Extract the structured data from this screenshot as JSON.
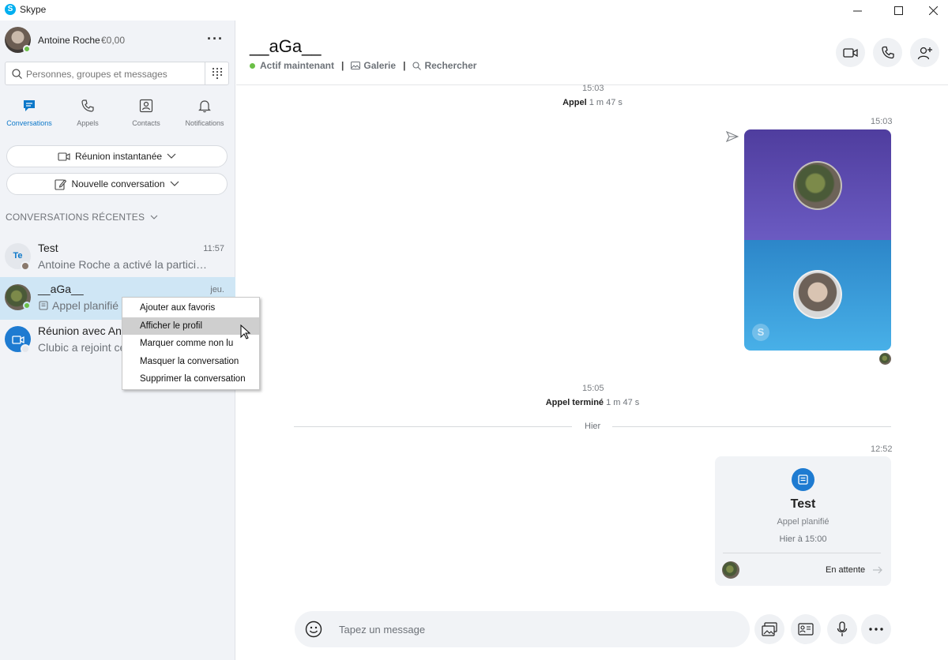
{
  "window": {
    "app_name": "Skype",
    "minimize_icon": "minimize-icon",
    "maximize_icon": "maximize-icon",
    "close_icon": "close-icon"
  },
  "profile": {
    "name": "Antoine Roche",
    "credit": "€0,00",
    "status": "online"
  },
  "search": {
    "placeholder": "Personnes, groupes et messages"
  },
  "nav": {
    "tabs": [
      {
        "label": "Conversations",
        "icon": "chat-icon",
        "active": true
      },
      {
        "label": "Appels",
        "icon": "phone-icon",
        "active": false
      },
      {
        "label": "Contacts",
        "icon": "contacts-icon",
        "active": false
      },
      {
        "label": "Notifications",
        "icon": "bell-icon",
        "active": false
      }
    ]
  },
  "actions": {
    "meet_now": "Réunion instantanée",
    "new_chat": "Nouvelle conversation"
  },
  "recent": {
    "title": "CONVERSATIONS RÉCENTES",
    "items": [
      {
        "name": "Test",
        "initials": "Te",
        "preview": "Antoine Roche a activé la partici…",
        "time": "11:57"
      },
      {
        "name": "__aGa__",
        "preview": "Appel planifié",
        "time": "jeu."
      },
      {
        "name": "Réunion avec Antoine Roche",
        "preview": "Clubic a rejoint cette conversation",
        "time": ""
      }
    ]
  },
  "context_menu": {
    "items": [
      "Ajouter aux favoris",
      "Afficher le profil",
      "Marquer comme non lu",
      "Masquer la conversation",
      "Supprimer la conversation"
    ],
    "highlighted_index": 1
  },
  "chat": {
    "title": "__aGa__",
    "status": "Actif maintenant",
    "gallery": "Galerie",
    "find": "Rechercher",
    "separator": "|"
  },
  "messages": {
    "top_time": "15:03",
    "call1_label": "Appel",
    "call1_duration": "1 m 47 s",
    "video_time": "15:03",
    "end_time": "15:05",
    "call2_label": "Appel terminé",
    "call2_duration": "1 m 47 s",
    "day_divider": "Hier",
    "card_time": "12:52",
    "card_title": "Test",
    "card_sub": "Appel planifié",
    "card_when": "Hier à 15:00",
    "card_status": "En attente"
  },
  "composer": {
    "placeholder": "Tapez un message"
  },
  "colors": {
    "accent": "#0d78c9",
    "online": "#6bbf47",
    "sidebar_bg": "#f1f3f7",
    "selected_row": "#cfe6f5"
  }
}
